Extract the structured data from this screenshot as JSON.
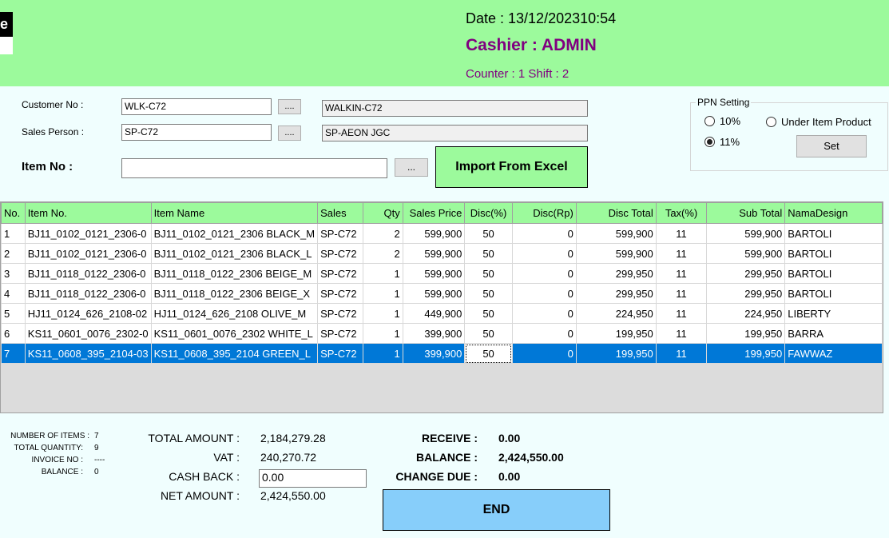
{
  "header": {
    "logo_letter": "e",
    "date": "Date : 13/12/2023",
    "time": "10:54",
    "cashier": "Cashier : ADMIN",
    "counter_shift": "Counter : 1 Shift : 2"
  },
  "form": {
    "customer_label": "Customer No :",
    "customer_no": "WLK-C72",
    "customer_name": "WALKIN-C72",
    "sales_label": "Sales Person :",
    "sales_no": "SP-C72",
    "sales_name": "SP-AEON JGC",
    "item_label": "Item No :",
    "item_value": "",
    "browse_label": "....",
    "browse_item_label": "...",
    "import_label": "Import From Excel"
  },
  "ppn": {
    "title": "PPN Setting",
    "option_10": "10%",
    "option_11": "11%",
    "option_under": "Under Item Product",
    "selected": "11%",
    "set_label": "Set"
  },
  "table": {
    "headers": [
      "No.",
      "Item No.",
      "Item Name",
      "Sales",
      "Qty",
      "Sales Price",
      "Disc(%)",
      "Disc(Rp)",
      "Disc Total",
      "Tax(%)",
      "Sub Total",
      "NamaDesign"
    ],
    "rows": [
      [
        "1",
        "BJ11_0102_0121_2306-0",
        "BJ11_0102_0121_2306 BLACK_M",
        "SP-C72",
        "2",
        "599,900",
        "50",
        "0",
        "599,900",
        "11",
        "599,900",
        "BARTOLI"
      ],
      [
        "2",
        "BJ11_0102_0121_2306-0",
        "BJ11_0102_0121_2306 BLACK_L",
        "SP-C72",
        "2",
        "599,900",
        "50",
        "0",
        "599,900",
        "11",
        "599,900",
        "BARTOLI"
      ],
      [
        "3",
        "BJ11_0118_0122_2306-0",
        "BJ11_0118_0122_2306 BEIGE_M",
        "SP-C72",
        "1",
        "599,900",
        "50",
        "0",
        "299,950",
        "11",
        "299,950",
        "BARTOLI"
      ],
      [
        "4",
        "BJ11_0118_0122_2306-0",
        "BJ11_0118_0122_2306 BEIGE_X",
        "SP-C72",
        "1",
        "599,900",
        "50",
        "0",
        "299,950",
        "11",
        "299,950",
        "BARTOLI"
      ],
      [
        "5",
        "HJ11_0124_626_2108-02",
        "HJ11_0124_626_2108 OLIVE_M",
        "SP-C72",
        "1",
        "449,900",
        "50",
        "0",
        "224,950",
        "11",
        "224,950",
        "LIBERTY"
      ],
      [
        "6",
        "KS11_0601_0076_2302-0",
        "KS11_0601_0076_2302 WHITE_L",
        "SP-C72",
        "1",
        "399,900",
        "50",
        "0",
        "199,950",
        "11",
        "199,950",
        "BARRA"
      ],
      [
        "7",
        "KS11_0608_395_2104-03",
        "KS11_0608_395_2104 GREEN_L",
        "SP-C72",
        "1",
        "399,900",
        "50",
        "0",
        "199,950",
        "11",
        "199,950",
        "FAWWAZ"
      ]
    ],
    "selected_row": 7
  },
  "summary": {
    "items_label": "NUMBER OF ITEMS :",
    "items_value": "7",
    "qty_label": "TOTAL QUANTITY:",
    "qty_value": "9",
    "invoice_label": "INVOICE NO :",
    "invoice_value": "----",
    "balance_label": "BALANCE :",
    "balance_value": "0"
  },
  "totals": {
    "total_amount_label": "TOTAL AMOUNT :",
    "total_amount": "2,184,279.28",
    "vat_label": "VAT :",
    "vat": "240,270.72",
    "cash_back_label": "CASH BACK :",
    "cash_back": "0.00",
    "net_amount_label": "NET AMOUNT :",
    "net_amount": "2,424,550.00"
  },
  "payment": {
    "receive_label": "RECEIVE :",
    "receive": "0.00",
    "balance_label": "BALANCE :",
    "balance": "2,424,550.00",
    "change_label": "CHANGE DUE :",
    "change": "0.00",
    "end_label": "END"
  },
  "colors": {
    "header_bg": "#9cfa9c",
    "page_bg": "#f0fefe",
    "cashier_text": "#800080",
    "selected_row": "#0078d7",
    "end_button": "#87cefa"
  }
}
